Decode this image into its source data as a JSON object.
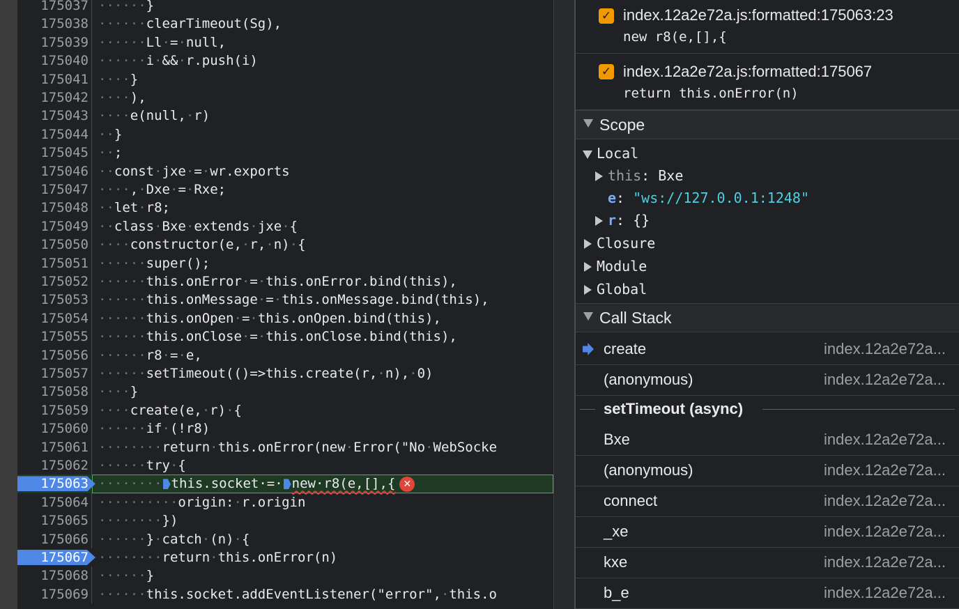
{
  "editor": {
    "lines": [
      {
        "num": "175037",
        "code": "······}"
      },
      {
        "num": "175038",
        "code": "······clearTimeout(Sg),"
      },
      {
        "num": "175039",
        "code": "······Ll·=·null,"
      },
      {
        "num": "175040",
        "code": "······i·&&·r.push(i)"
      },
      {
        "num": "175041",
        "code": "····}"
      },
      {
        "num": "175042",
        "code": "····),"
      },
      {
        "num": "175043",
        "code": "····e(null,·r)"
      },
      {
        "num": "175044",
        "code": "··}"
      },
      {
        "num": "175045",
        "code": "··;"
      },
      {
        "num": "175046",
        "code": "··const·jxe·=·wr.exports"
      },
      {
        "num": "175047",
        "code": "····,·Dxe·=·Rxe;"
      },
      {
        "num": "175048",
        "code": "··let·r8;"
      },
      {
        "num": "175049",
        "code": "··class·Bxe·extends·jxe·{"
      },
      {
        "num": "175050",
        "code": "····constructor(e,·r,·n)·{"
      },
      {
        "num": "175051",
        "code": "······super();"
      },
      {
        "num": "175052",
        "code": "······this.onError·=·this.onError.bind(this),"
      },
      {
        "num": "175053",
        "code": "······this.onMessage·=·this.onMessage.bind(this),"
      },
      {
        "num": "175054",
        "code": "······this.onOpen·=·this.onOpen.bind(this),"
      },
      {
        "num": "175055",
        "code": "······this.onClose·=·this.onClose.bind(this),"
      },
      {
        "num": "175056",
        "code": "······r8·=·e,"
      },
      {
        "num": "175057",
        "code": "······setTimeout(()=>this.create(r,·n),·0)"
      },
      {
        "num": "175058",
        "code": "····}"
      },
      {
        "num": "175059",
        "code": "····create(e,·r)·{"
      },
      {
        "num": "175060",
        "code": "······if·(!r8)"
      },
      {
        "num": "175061",
        "code": "········return·this.onError(new·Error(\"No·WebSocke"
      },
      {
        "num": "175062",
        "code": "······try·{"
      },
      {
        "num": "175063",
        "code_a": "········",
        "code_b": "this.socket·=·",
        "code_c": "new·r8(e,[],{",
        "paused": true
      },
      {
        "num": "175064",
        "code": "··········origin:·r.origin"
      },
      {
        "num": "175065",
        "code": "········})"
      },
      {
        "num": "175066",
        "code": "······}·catch·(n)·{"
      },
      {
        "num": "175067",
        "code": "········return·this.onError(n)",
        "bp": true
      },
      {
        "num": "175068",
        "code": "······}"
      },
      {
        "num": "175069",
        "code": "······this.socket.addEventListener(\"error\",·this.o"
      }
    ]
  },
  "breakpoints": [
    {
      "location": "index.12a2e72a.js:formatted:175063:23",
      "code": "new r8(e,[],{",
      "checked": true
    },
    {
      "location": "index.12a2e72a.js:formatted:175067",
      "code": "return this.onError(n)",
      "checked": true
    }
  ],
  "scope": {
    "title": "Scope",
    "local_label": "Local",
    "this_key": "this",
    "this_value": "Bxe",
    "e_key": "e",
    "e_value": "\"ws://127.0.0.1:1248\"",
    "r_key": "r",
    "r_value": "{}",
    "closure_label": "Closure",
    "module_label": "Module",
    "global_label": "Global"
  },
  "call_stack": {
    "title": "Call Stack",
    "frames": [
      {
        "fn": "create",
        "loc": "index.12a2e72a..."
      },
      {
        "fn": "(anonymous)",
        "loc": "index.12a2e72a..."
      },
      {
        "fn": "Bxe",
        "loc": "index.12a2e72a..."
      },
      {
        "fn": "(anonymous)",
        "loc": "index.12a2e72a..."
      },
      {
        "fn": "connect",
        "loc": "index.12a2e72a..."
      },
      {
        "fn": "_xe",
        "loc": "index.12a2e72a..."
      },
      {
        "fn": "kxe",
        "loc": "index.12a2e72a..."
      },
      {
        "fn": "b_e",
        "loc": "index.12a2e72a..."
      }
    ],
    "async_label": "setTimeout (async)"
  },
  "colors": {
    "breakpoint": "#4e87e6",
    "paused_line": "#1e3a25",
    "checkbox": "#f29900",
    "error": "#e0453a"
  }
}
